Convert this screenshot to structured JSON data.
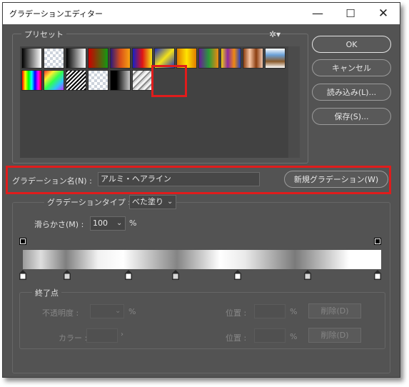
{
  "window": {
    "title": "グラデーションエディター",
    "minimize_glyph": "—",
    "maximize_glyph": "☐",
    "close_glyph": "✕"
  },
  "presets": {
    "label": "プリセット",
    "settings_icon": "gear-icon",
    "settings_glyph": "✲▾",
    "swatches": [
      {
        "name": "foreground-to-background",
        "style": "linear-gradient(90deg,#000000,#ffffff)"
      },
      {
        "name": "foreground-to-transparent",
        "style": "checker"
      },
      {
        "name": "black-white",
        "style": "linear-gradient(90deg,#000000,#ffffff)"
      },
      {
        "name": "red-green",
        "style": "linear-gradient(90deg,#cc0000,#139a13)"
      },
      {
        "name": "violet-orange",
        "style": "linear-gradient(90deg,#2b1a7a,#d94e18,#f7a212)"
      },
      {
        "name": "blue-red-yellow",
        "style": "linear-gradient(90deg,#1420c8,#e01414,#f0e614)"
      },
      {
        "name": "blue-yellow-blue",
        "style": "linear-gradient(135deg,#1c2dc0,#f2e21a,#1c2dc0)"
      },
      {
        "name": "orange-yellow-orange",
        "style": "linear-gradient(90deg,#e07a00,#ffe400,#e07a00)"
      },
      {
        "name": "violet-green-orange",
        "style": "linear-gradient(90deg,#6a1b9a,#2a9a3a,#ef8a10)"
      },
      {
        "name": "yellow-violet-orange-blue",
        "style": "linear-gradient(90deg,#f0d010,#8a2aa0,#f08a10,#2040c0)"
      },
      {
        "name": "copper",
        "style": "linear-gradient(90deg,#8a3c0f,#f6c5a4,#8a3c0f,#f2c9b0)"
      },
      {
        "name": "chrome",
        "style": "linear-gradient(180deg,#ffffff,#6aa0d8,#8a5a2a,#ffffff)"
      },
      {
        "name": "spectrum",
        "style": "linear-gradient(90deg,#ff0000,#ffff00,#00ff00,#00ffff,#0000ff,#ff00ff,#ff0000)"
      },
      {
        "name": "transparent-rainbow",
        "style": "linear-gradient(135deg,#ff3030,#ffee30,#30ff50,#30c0ff,#c030ff)"
      },
      {
        "name": "transparent-stripes",
        "style": "repeating-linear-gradient(135deg,#000000 0 2px,#ffffff 2px 4px)"
      },
      {
        "name": "neutral-density",
        "style": "checker"
      },
      {
        "name": "black-to-transparent",
        "style": "linear-gradient(90deg,#000000 0%,#000000 30%,#c8c8c8 100%)"
      },
      {
        "name": "aluminum-hairline",
        "style": "repeating-linear-gradient(135deg,#f4f4f4 0 3px,#8a8a8a 3px 5px,#d6d6d6 5px 7px)"
      }
    ]
  },
  "buttons": {
    "ok": "OK",
    "cancel": "キャンセル",
    "load": "読み込み(L)...",
    "save": "保存(S)...",
    "new_gradient": "新規グラデーション(W)"
  },
  "name_field": {
    "label": "グラデーション名(N) :",
    "value": "アルミ・ヘアライン"
  },
  "gradient_type": {
    "label": "グラデーションタイプ :",
    "value": "べた塗り"
  },
  "smoothness": {
    "label": "滑らかさ(M) :",
    "value": "100",
    "unit": "%"
  },
  "stops": {
    "label": "終了点",
    "opacity_label": "不透明度 :",
    "opacity_unit": "%",
    "opacity_location_label": "位置 :",
    "opacity_location_unit": "%",
    "opacity_delete": "削除(D)",
    "color_label": "カラー :",
    "color_location_label": "位置 :",
    "color_location_unit": "%",
    "color_delete": "削除(D)"
  },
  "colors": {
    "dialog_bg": "#535353",
    "highlight": "#e01c1c"
  }
}
